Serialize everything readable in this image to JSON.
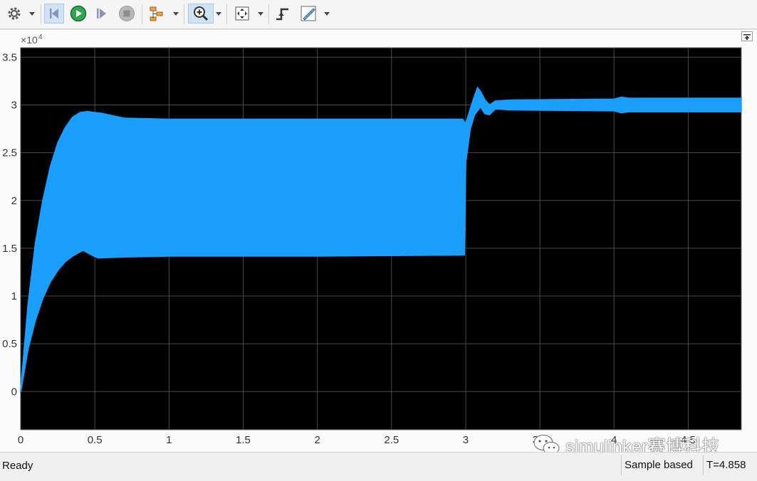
{
  "toolbar": {
    "buttons": [
      {
        "name": "settings-button",
        "icon": "gear-icon"
      },
      {
        "name": "step-back-button",
        "icon": "step-back-icon"
      },
      {
        "name": "run-button",
        "icon": "play-icon"
      },
      {
        "name": "step-forward-button",
        "icon": "step-forward-icon"
      },
      {
        "name": "stop-button",
        "icon": "stop-icon"
      },
      {
        "name": "signal-selector-button",
        "icon": "hierarchy-icon"
      },
      {
        "name": "zoom-in-button",
        "icon": "zoom-in-icon",
        "active": true
      },
      {
        "name": "autoscale-button",
        "icon": "autoscale-icon"
      },
      {
        "name": "trigger-button",
        "icon": "trigger-icon"
      },
      {
        "name": "cursor-measure-button",
        "icon": "ruler-icon"
      }
    ]
  },
  "chart_data": {
    "type": "line",
    "title": "",
    "xlabel": "",
    "ylabel": "",
    "y_exponent_label": "×10",
    "y_exponent_power": "4",
    "xlim": [
      0,
      4.858
    ],
    "ylim": [
      -0.4,
      3.6
    ],
    "grid": true,
    "background": "#000000",
    "line_color": "#1a9fff",
    "x_ticks": [
      "0",
      "0.5",
      "1",
      "1.5",
      "2",
      "2.5",
      "3",
      "3.5",
      "4",
      "4.5"
    ],
    "y_ticks": [
      "0",
      "0.5",
      "1",
      "1.5",
      "2",
      "2.5",
      "3",
      "3.5"
    ],
    "series": [
      {
        "upper_envelope": [
          [
            0,
            0
          ],
          [
            0.05,
            0.9
          ],
          [
            0.1,
            1.55
          ],
          [
            0.15,
            2.0
          ],
          [
            0.2,
            2.35
          ],
          [
            0.25,
            2.6
          ],
          [
            0.3,
            2.76
          ],
          [
            0.35,
            2.87
          ],
          [
            0.4,
            2.92
          ],
          [
            0.45,
            2.93
          ],
          [
            0.55,
            2.91
          ],
          [
            0.7,
            2.86
          ],
          [
            1.0,
            2.85
          ],
          [
            2.0,
            2.85
          ],
          [
            2.98,
            2.85
          ],
          [
            3.0,
            2.8
          ],
          [
            3.02,
            2.9
          ],
          [
            3.05,
            3.05
          ],
          [
            3.08,
            3.18
          ],
          [
            3.1,
            3.14
          ],
          [
            3.13,
            3.05
          ],
          [
            3.16,
            3.0
          ],
          [
            3.2,
            3.04
          ],
          [
            3.3,
            3.05
          ],
          [
            4.0,
            3.06
          ],
          [
            4.05,
            3.08
          ],
          [
            4.1,
            3.07
          ],
          [
            4.858,
            3.07
          ]
        ],
        "lower_envelope": [
          [
            0,
            0
          ],
          [
            0.05,
            0.45
          ],
          [
            0.1,
            0.75
          ],
          [
            0.15,
            0.98
          ],
          [
            0.2,
            1.15
          ],
          [
            0.25,
            1.27
          ],
          [
            0.3,
            1.36
          ],
          [
            0.35,
            1.42
          ],
          [
            0.42,
            1.48
          ],
          [
            0.48,
            1.43
          ],
          [
            0.52,
            1.4
          ],
          [
            0.7,
            1.41
          ],
          [
            1.0,
            1.42
          ],
          [
            2.0,
            1.42
          ],
          [
            2.99,
            1.43
          ],
          [
            3.0,
            2.4
          ],
          [
            3.03,
            2.75
          ],
          [
            3.06,
            2.9
          ],
          [
            3.1,
            2.98
          ],
          [
            3.13,
            2.91
          ],
          [
            3.16,
            2.9
          ],
          [
            3.2,
            2.96
          ],
          [
            3.3,
            2.95
          ],
          [
            4.0,
            2.94
          ],
          [
            4.05,
            2.92
          ],
          [
            4.1,
            2.93
          ],
          [
            4.858,
            2.93
          ]
        ]
      }
    ]
  },
  "status": {
    "left": "Ready",
    "mode": "Sample based",
    "time": "T=4.858"
  },
  "watermark": {
    "text": "simulinker赛博科技",
    "icon": "wechat-icon"
  }
}
